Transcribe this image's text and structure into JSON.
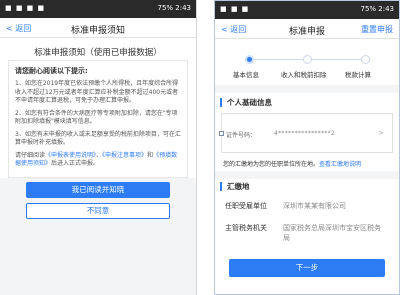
{
  "left": {
    "status": {
      "left": "■ ■ ■ ■",
      "right": "75% 2:43"
    },
    "nav": {
      "back": "< 返回",
      "title": "标准申报须知"
    },
    "doc_title": "标准申报须知（使用已申报数据）",
    "intro": "请您耐心阅读以下提示:",
    "paragraphs": [
      "1、如您在2019年度已依法预缴个人所得税，且年度综合所得收入不超过12万元或者年度汇算应补税金额不超过400元或者不申请年度汇算退税，可免于办理汇算申报。",
      "2、如您有符合条件的大病医疗等专项附加扣除，请您在\"专项附加扣除填报\"模块填写信息。",
      "3、如您有未申报的收入或未足额享受的税前扣除项目，可在汇算申报时补充填报。"
    ],
    "last_para": {
      "before": "请仔细阅读",
      "link1": "《申报表使用说明》",
      "mid1": "、",
      "link2": "《申报注意事项》",
      "mid2": "和",
      "link3": "《预填数据使用须知》",
      "after": "后进入正式申报。"
    },
    "btn_read": "我已阅读并知晓",
    "btn_no": "不同意"
  },
  "right": {
    "status": {
      "left": "■ ■ ■",
      "right": "75% 2:43"
    },
    "nav": {
      "back": "< 返回",
      "title": "标准申报",
      "action": "重置申报"
    },
    "steps": [
      "基本信息",
      "收入和税前扣除",
      "税款计算"
    ],
    "section1": "个人基础信息",
    "id_label": "证件号码：",
    "id_value": "4****************2",
    "hint_text": "您的汇缴地为您的任职单位所在地。",
    "hint_link": "查看汇缴地说明",
    "section2": "汇缴地",
    "employer_label": "任职受雇单位",
    "employer_value": "深圳市某某有限公司",
    "tax_label": "主管税务机关",
    "tax_value": "国家税务总局深圳市宝安区税务局",
    "next": "下一步"
  }
}
